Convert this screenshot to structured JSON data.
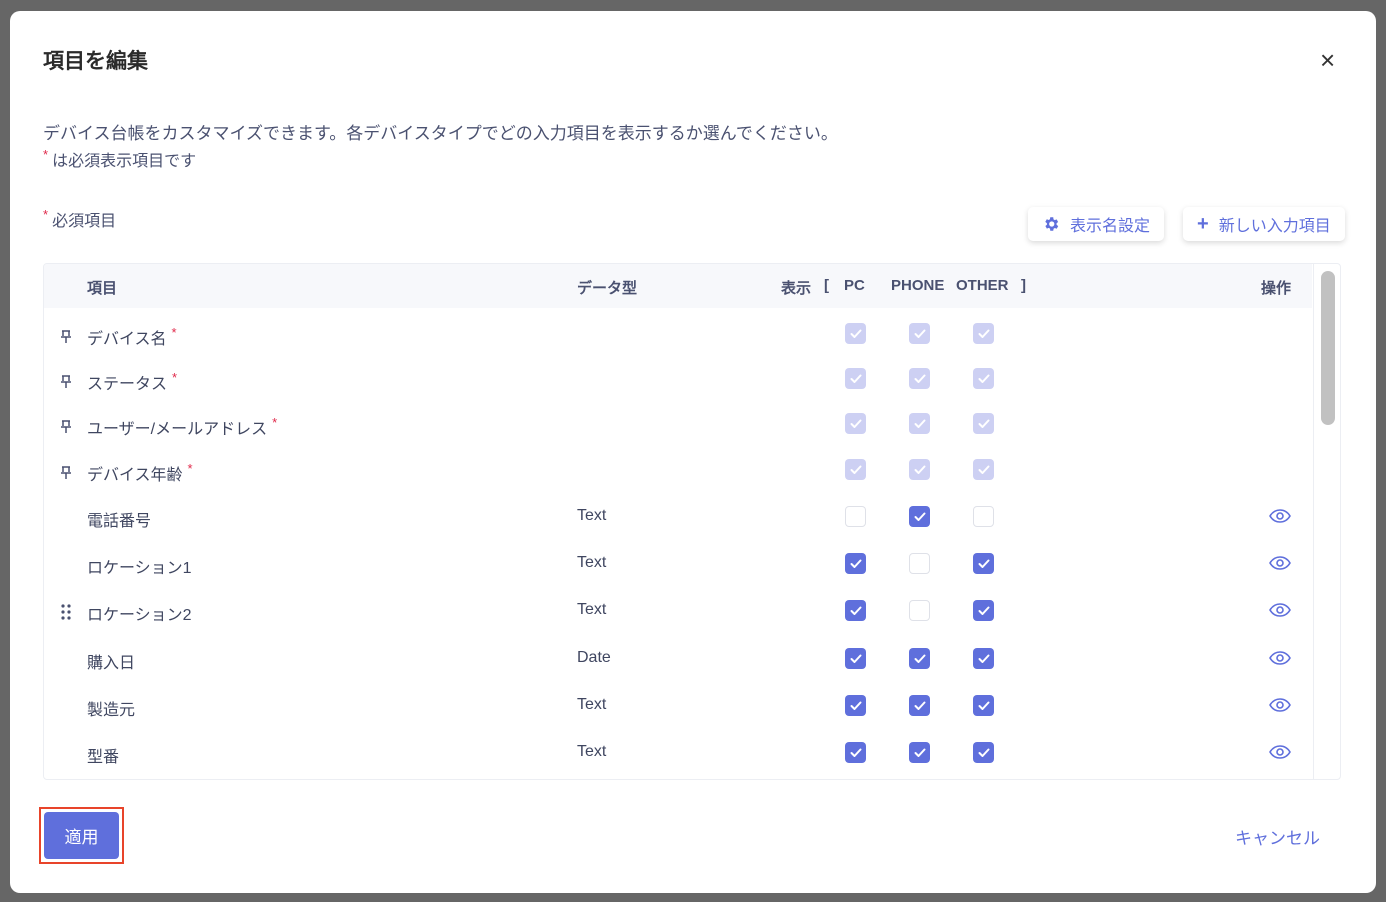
{
  "dialog": {
    "title": "項目を編集",
    "close": "×",
    "description": "デバイス台帳をカスタマイズできます。各デバイスタイプでどの入力項目を表示するか選んでください。",
    "note": "は必須表示項目です",
    "required_label": "必須項目",
    "star": "*",
    "display_name_button": "表示名設定",
    "new_field_button": "新しい入力項目"
  },
  "table": {
    "headers": {
      "item": "項目",
      "type": "データ型",
      "display": "表示",
      "open": "[",
      "pc": "PC",
      "phone": "PHONE",
      "other": "OTHER",
      "close": "]",
      "actions": "操作"
    },
    "rows": [
      {
        "name": "デバイス名",
        "required": true,
        "type": "",
        "pc": "dis",
        "phone": "dis",
        "other": "dis",
        "icon": "pin"
      },
      {
        "name": "ステータス",
        "required": true,
        "type": "",
        "pc": "dis",
        "phone": "dis",
        "other": "dis",
        "icon": "pin"
      },
      {
        "name": "ユーザー/メールアドレス",
        "required": true,
        "type": "",
        "pc": "dis",
        "phone": "dis",
        "other": "dis",
        "icon": "pin"
      },
      {
        "name": "デバイス年齢",
        "required": true,
        "type": "",
        "pc": "dis",
        "phone": "dis",
        "other": "dis",
        "icon": "pin"
      },
      {
        "name": "電話番号",
        "required": false,
        "type": "Text",
        "pc": "off",
        "phone": "on",
        "other": "off",
        "icon": ""
      },
      {
        "name": "ロケーション1",
        "required": false,
        "type": "Text",
        "pc": "on",
        "phone": "off",
        "other": "on",
        "icon": ""
      },
      {
        "name": "ロケーション2",
        "required": false,
        "type": "Text",
        "pc": "on",
        "phone": "off",
        "other": "on",
        "icon": "drag"
      },
      {
        "name": "購入日",
        "required": false,
        "type": "Date",
        "pc": "on",
        "phone": "on",
        "other": "on",
        "icon": ""
      },
      {
        "name": "製造元",
        "required": false,
        "type": "Text",
        "pc": "on",
        "phone": "on",
        "other": "on",
        "icon": ""
      },
      {
        "name": "型番",
        "required": false,
        "type": "Text",
        "pc": "on",
        "phone": "on",
        "other": "on",
        "icon": ""
      }
    ]
  },
  "footer": {
    "apply": "適用",
    "cancel": "キャンセル"
  },
  "colors": {
    "accent": "#5f6fdc",
    "required": "#e0294a",
    "highlight": "#e8442a"
  }
}
